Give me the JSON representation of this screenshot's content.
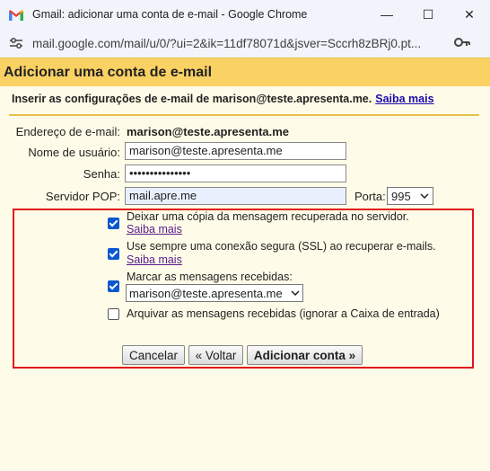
{
  "window": {
    "title": "Gmail: adicionar uma conta de e-mail - Google Chrome",
    "minimize": "—",
    "maximize": "☐",
    "close": "✕"
  },
  "address": {
    "url": "mail.google.com/mail/u/0/?ui=2&ik=11df78071d&jsver=Sccrh8zBRj0.pt..."
  },
  "dialog": {
    "heading": "Adicionar uma conta de e-mail",
    "instruction": "Inserir as configurações de e-mail de marison@teste.apresenta.me.",
    "learn_more": "Saiba mais"
  },
  "form": {
    "email_label": "Endereço de e-mail:",
    "email_value": "marison@teste.apresenta.me",
    "username_label": "Nome de usuário:",
    "username_value": "marison@teste.apresenta.me",
    "password_label": "Senha:",
    "password_value": "•••••••••••••••",
    "pop_label": "Servidor POP:",
    "pop_value": "mail.apre.me",
    "port_label": "Porta:",
    "port_value": "995"
  },
  "options": {
    "leave_copy": {
      "label": "Deixar uma cópia da mensagem recuperada no servidor.",
      "link": "Saiba mais",
      "checked": true
    },
    "ssl": {
      "label": "Use sempre uma conexão segura (SSL) ao recuperar e-mails.",
      "link": "Saiba mais",
      "checked": true
    },
    "label_incoming": {
      "label": "Marcar as mensagens recebidas:",
      "select_value": "marison@teste.apresenta.me",
      "checked": true
    },
    "archive": {
      "label": "Arquivar as mensagens recebidas (ignorar a Caixa de entrada)",
      "checked": false
    }
  },
  "buttons": {
    "cancel": "Cancelar",
    "back": "« Voltar",
    "add": "Adicionar conta »"
  },
  "colors": {
    "header": "#fad163",
    "highlight_border": "#e0161b",
    "checkbox": "#0b57d0"
  }
}
